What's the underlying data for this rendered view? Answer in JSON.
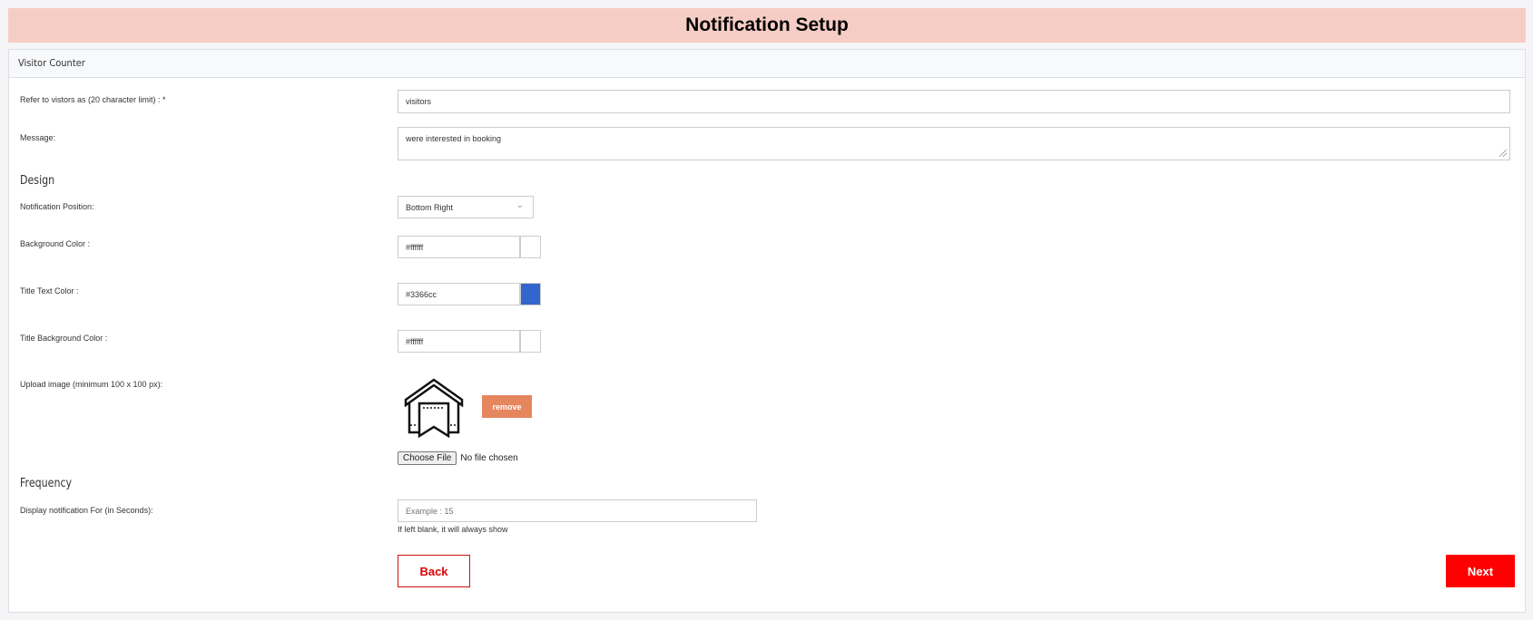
{
  "header": {
    "title": "Notification Setup"
  },
  "panel": {
    "title": "Visitor Counter"
  },
  "fields": {
    "refer_label": "Refer to vistors as (20 character limit) : *",
    "refer_value": "visitors",
    "message_label": "Message:",
    "message_value": "were interested in booking"
  },
  "design": {
    "heading": "Design",
    "position_label": "Notification Position:",
    "position_value": "Bottom Right",
    "bg_label": "Background Color :",
    "bg_value": "#ffffff",
    "title_text_label": "Title Text Color :",
    "title_text_value": "#3366cc",
    "title_bg_label": "Title Background Color :",
    "title_bg_value": "#ffffff",
    "upload_label": "Upload image (minimum 100 x 100 px):",
    "remove_label": "remove",
    "choose_file_label": "Choose File",
    "no_file_label": "No file chosen"
  },
  "frequency": {
    "heading": "Frequency",
    "display_label": "Display notification For (in Seconds):",
    "display_placeholder": "Example : 15",
    "hint": "If left blank, it will always show"
  },
  "actions": {
    "back_label": "Back",
    "next_label": "Next"
  },
  "colors": {
    "accent": "#ff0000",
    "remove": "#e5865f",
    "header_bg": "#f6cdc5"
  }
}
